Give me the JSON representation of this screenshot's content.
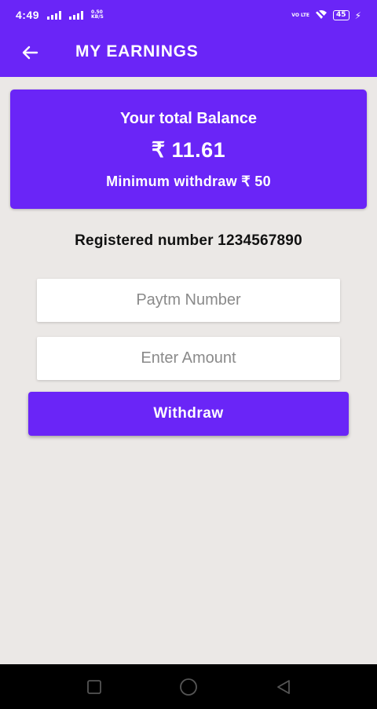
{
  "status_bar": {
    "time": "4:49",
    "net_speed_value": "0.50",
    "net_speed_unit": "KB/S",
    "volte": "VO LTE",
    "battery": "45"
  },
  "app_bar": {
    "title": "MY EARNINGS",
    "back_icon": "arrow-left-icon"
  },
  "balance_card": {
    "label": "Your total Balance",
    "amount": "₹ 11.61",
    "minimum": "Minimum withdraw ₹ 50"
  },
  "registered": {
    "text": "Registered number 1234567890"
  },
  "form": {
    "paytm_placeholder": "Paytm Number",
    "paytm_value": "",
    "amount_placeholder": "Enter Amount",
    "amount_value": "",
    "withdraw_label": "Withdraw"
  },
  "nav_bar": {
    "icons": [
      "square-icon",
      "circle-icon",
      "triangle-back-icon"
    ]
  },
  "colors": {
    "primary": "#6a25f7",
    "background": "#ebe8e6",
    "nav_background": "#000000"
  }
}
